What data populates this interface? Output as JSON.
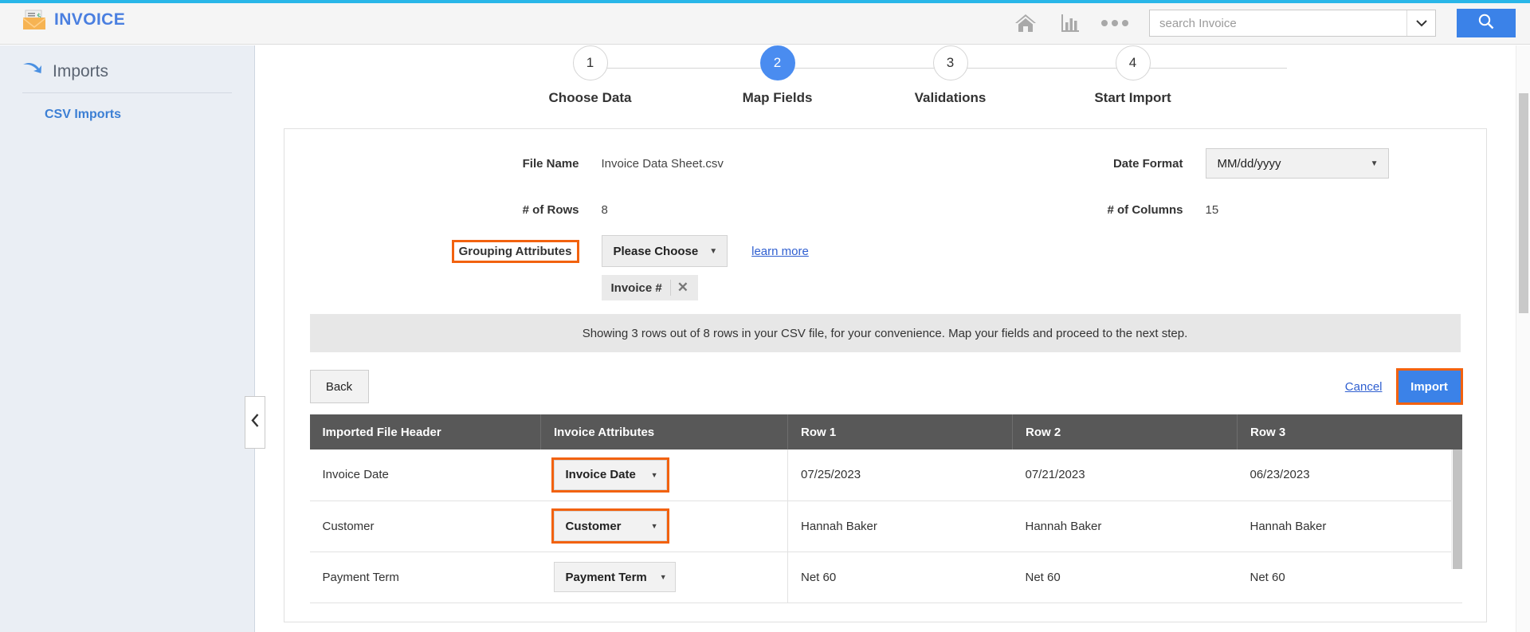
{
  "theme": {
    "accent_blue": "#3b82e8",
    "top_bar": "#29b6e8",
    "highlight_orange": "#f2620f",
    "table_header": "#585858"
  },
  "header": {
    "app_title": "INVOICE",
    "logo_icon": "envelope-invoice-icon",
    "home_icon": "home-icon",
    "reports_icon": "bar-chart-icon",
    "more_icon": "more-dots-icon",
    "search_caret_icon": "chevron-down-icon",
    "search_icon": "search-icon",
    "search": {
      "placeholder": "search Invoice",
      "value": ""
    }
  },
  "sidebar": {
    "section_label": "Imports",
    "section_icon": "import-arrow-icon",
    "items": [
      {
        "label": "CSV Imports",
        "active": true
      }
    ],
    "collapse_icon": "chevron-left-icon"
  },
  "stepper": {
    "steps": [
      {
        "number": "1",
        "label": "Choose Data",
        "active": false
      },
      {
        "number": "2",
        "label": "Map Fields",
        "active": true
      },
      {
        "number": "3",
        "label": "Validations",
        "active": false
      },
      {
        "number": "4",
        "label": "Start Import",
        "active": false
      }
    ]
  },
  "form": {
    "file_name_label": "File Name",
    "file_name_value": "Invoice Data Sheet.csv",
    "date_format_label": "Date Format",
    "date_format_value": "MM/dd/yyyy",
    "rows_label": "# of Rows",
    "rows_value": "8",
    "columns_label": "# of Columns",
    "columns_value": "15",
    "grouping_attributes_label": "Grouping Attributes",
    "grouping_choose_label": "Please Choose",
    "learn_more_label": "learn more",
    "grouping_chips": [
      {
        "label": "Invoice #",
        "remove_icon": "close-icon"
      }
    ]
  },
  "info_bar": {
    "message": "Showing 3 rows out of 8 rows in your CSV file, for your convenience. Map your fields and proceed to the next step."
  },
  "actions": {
    "back_label": "Back",
    "cancel_label": "Cancel",
    "import_label": "Import"
  },
  "table": {
    "columns": [
      "Imported File Header",
      "Invoice Attributes",
      "Row 1",
      "Row 2",
      "Row 3"
    ],
    "rows": [
      {
        "header": "Invoice Date",
        "attribute": "Invoice Date",
        "highlighted": true,
        "row1": "07/25/2023",
        "row2": "07/21/2023",
        "row3": "06/23/2023"
      },
      {
        "header": "Customer",
        "attribute": "Customer",
        "highlighted": true,
        "row1": "Hannah Baker",
        "row2": "Hannah Baker",
        "row3": "Hannah Baker"
      },
      {
        "header": "Payment Term",
        "attribute": "Payment Term",
        "highlighted": false,
        "row1": "Net 60",
        "row2": "Net 60",
        "row3": "Net 60"
      }
    ]
  }
}
